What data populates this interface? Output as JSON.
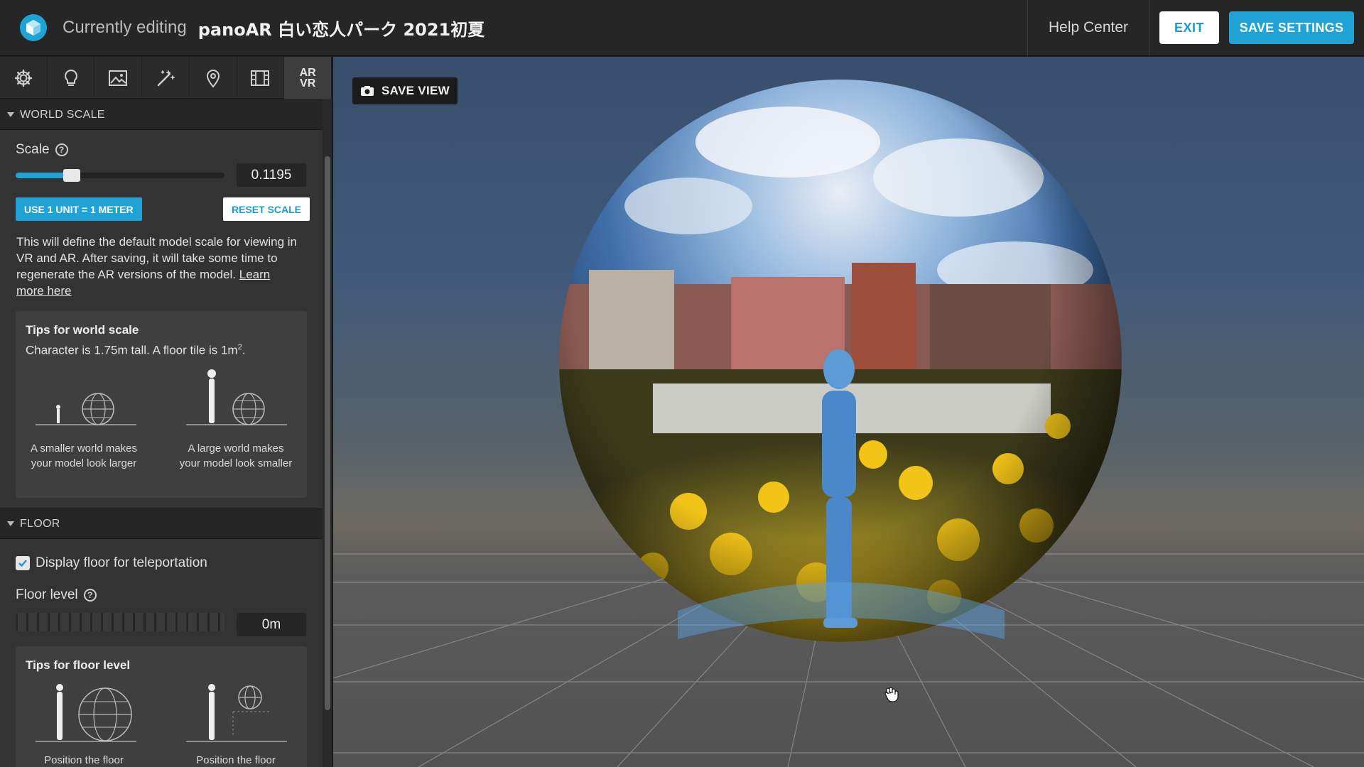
{
  "header": {
    "editing_label": "Currently editing",
    "project_title": "panoAR 白い恋人パーク 2021初夏",
    "help_center": "Help Center",
    "exit_label": "EXIT",
    "save_settings_label": "SAVE SETTINGS"
  },
  "tabs": [
    {
      "icon": "gear-icon"
    },
    {
      "icon": "lightbulb-icon"
    },
    {
      "icon": "image-icon"
    },
    {
      "icon": "magic-wand-icon"
    },
    {
      "icon": "map-pin-icon"
    },
    {
      "icon": "film-icon"
    },
    {
      "label_top": "AR",
      "label_bottom": "VR",
      "active": true
    }
  ],
  "world_scale": {
    "header": "WORLD SCALE",
    "scale_label": "Scale",
    "scale_value": "0.1195",
    "slider_fraction": 0.27,
    "use_1_unit_label": "USE 1 UNIT = 1 METER",
    "reset_scale_label": "RESET SCALE",
    "description": "This will define the default model scale for viewing in VR and AR. After saving, it will take some time to regenerate the AR versions of the model.",
    "learn_more": "Learn more here",
    "tips_title": "Tips for world scale",
    "tips_subtitle": "Character is 1.75m tall. A floor tile is 1m",
    "tips_superscript": "2",
    "tips_suffix": ".",
    "caption_small": "A smaller world makes your model look larger",
    "caption_large": "A large world makes your model look smaller"
  },
  "floor": {
    "header": "FLOOR",
    "display_floor_label": "Display floor for teleportation",
    "display_floor_checked": true,
    "floor_level_label": "Floor level",
    "floor_level_value": "0m",
    "tips_title": "Tips for floor level",
    "caption_left": "Position the floor",
    "caption_right": "Position the floor"
  },
  "viewport": {
    "save_view_label": "SAVE VIEW"
  },
  "colors": {
    "accent": "#1fa3d6",
    "topbar_bg": "#262626",
    "sidebar_bg": "#333333"
  }
}
